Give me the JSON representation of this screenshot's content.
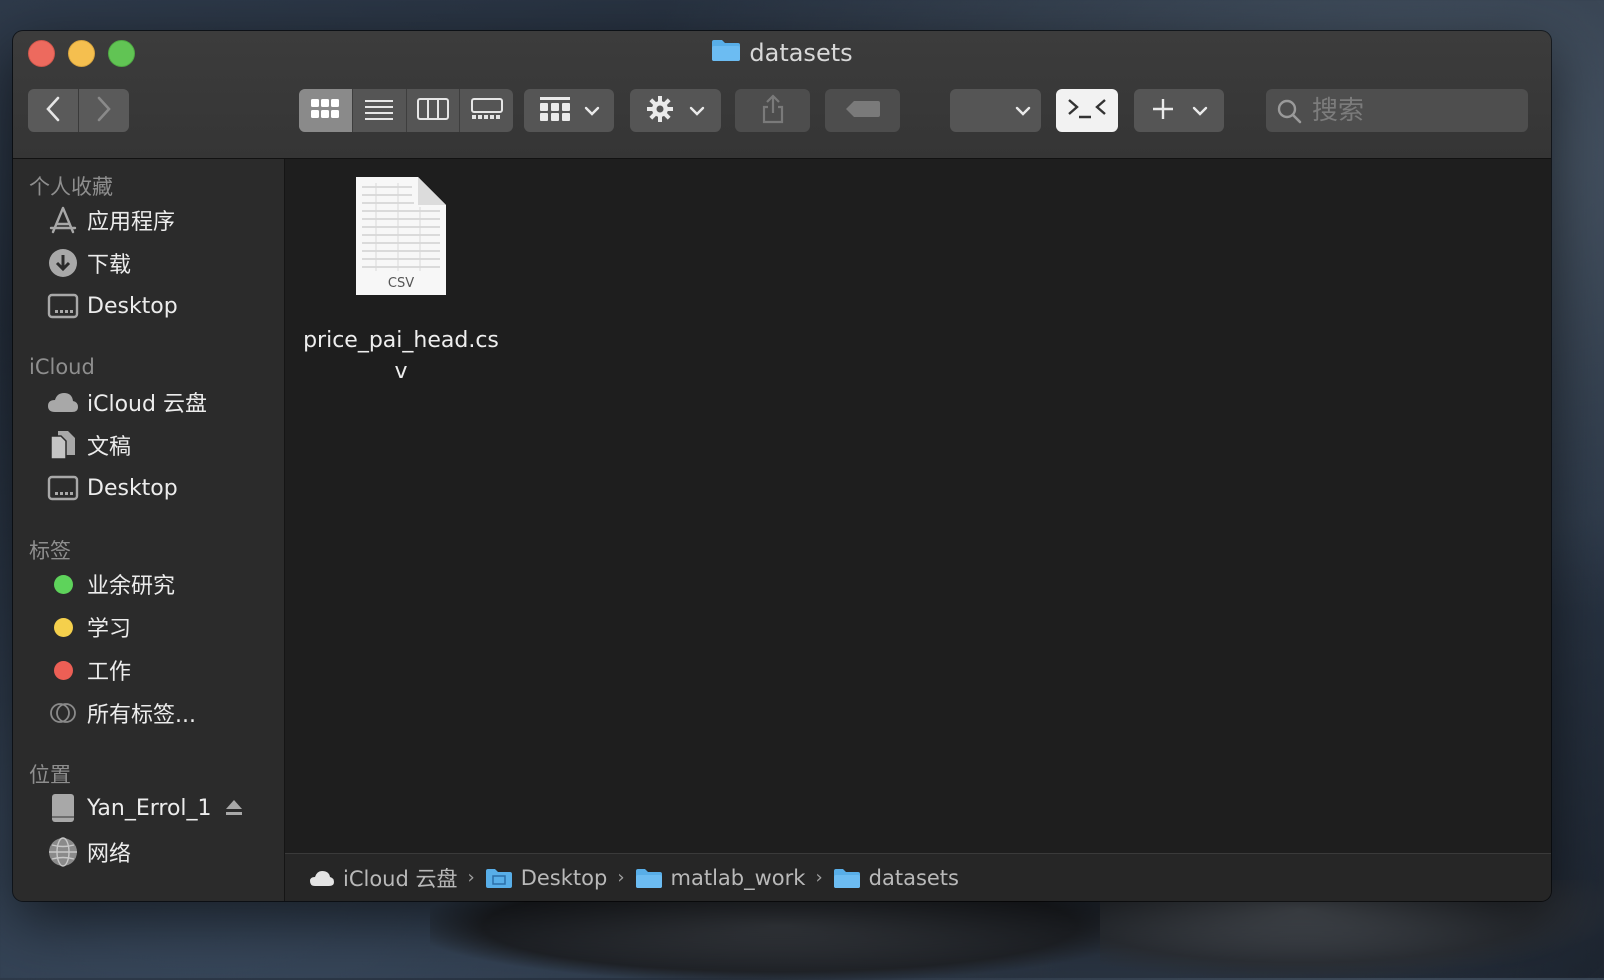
{
  "window": {
    "title": "datasets"
  },
  "toolbar": {
    "search_placeholder": "搜索"
  },
  "sidebar": {
    "favorites_title": "个人收藏",
    "favorites": [
      "应用程序",
      "下载",
      "Desktop"
    ],
    "icloud_title": "iCloud",
    "icloud": [
      "iCloud 云盘",
      "文稿",
      "Desktop"
    ],
    "tags_title": "标签",
    "tags": [
      {
        "label": "业余研究",
        "color": "#5ed35b"
      },
      {
        "label": "学习",
        "color": "#f5d04c"
      },
      {
        "label": "工作",
        "color": "#ec5f55"
      },
      {
        "label": "所有标签..."
      }
    ],
    "locations_title": "位置",
    "locations": [
      "Yan_Errol_1",
      "网络"
    ]
  },
  "files": [
    {
      "name": "price_pai_head.csv",
      "type_label": "CSV"
    }
  ],
  "pathbar": [
    "iCloud 云盘",
    "Desktop",
    "matlab_work",
    "datasets"
  ]
}
